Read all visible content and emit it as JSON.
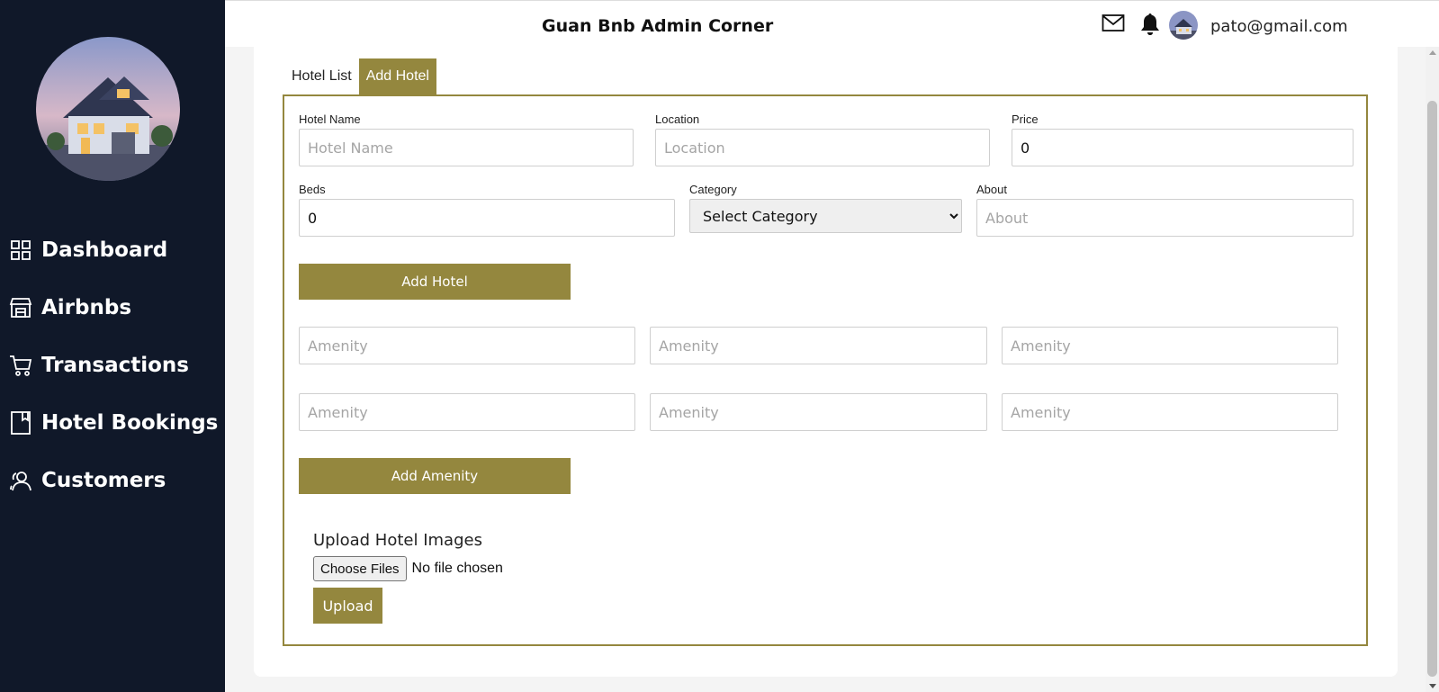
{
  "sidebar": {
    "logo_icon": "house-photo",
    "items": [
      {
        "label": "Dashboard",
        "icon": "grid-icon"
      },
      {
        "label": "Airbnbs",
        "icon": "store-icon"
      },
      {
        "label": "Transactions",
        "icon": "cart-icon"
      },
      {
        "label": "Hotel Bookings",
        "icon": "book-icon"
      },
      {
        "label": "Customers",
        "icon": "users-icon"
      }
    ]
  },
  "header": {
    "title": "Guan Bnb Admin Corner",
    "email": "pato@gmail.com",
    "icons": [
      "mail-icon",
      "bell-icon",
      "avatar"
    ]
  },
  "tabs": [
    {
      "label": "Hotel List",
      "active": false
    },
    {
      "label": "Add Hotel",
      "active": true
    }
  ],
  "form": {
    "hotel_name": {
      "label": "Hotel Name",
      "placeholder": "Hotel Name",
      "value": ""
    },
    "location": {
      "label": "Location",
      "placeholder": "Location",
      "value": ""
    },
    "price": {
      "label": "Price",
      "placeholder": "",
      "value": "0"
    },
    "beds": {
      "label": "Beds",
      "placeholder": "",
      "value": "0"
    },
    "category": {
      "label": "Category",
      "selected": "Select Category"
    },
    "about": {
      "label": "About",
      "placeholder": "About",
      "value": ""
    },
    "add_hotel_button": "Add Hotel",
    "amenity_placeholder": "Amenity",
    "add_amenity_button": "Add Amenity",
    "upload_title": "Upload Hotel Images",
    "choose_files_button": "Choose Files",
    "file_status": "No file chosen",
    "upload_button": "Upload"
  },
  "colors": {
    "sidebar_bg": "#101829",
    "accent": "#94873e"
  }
}
